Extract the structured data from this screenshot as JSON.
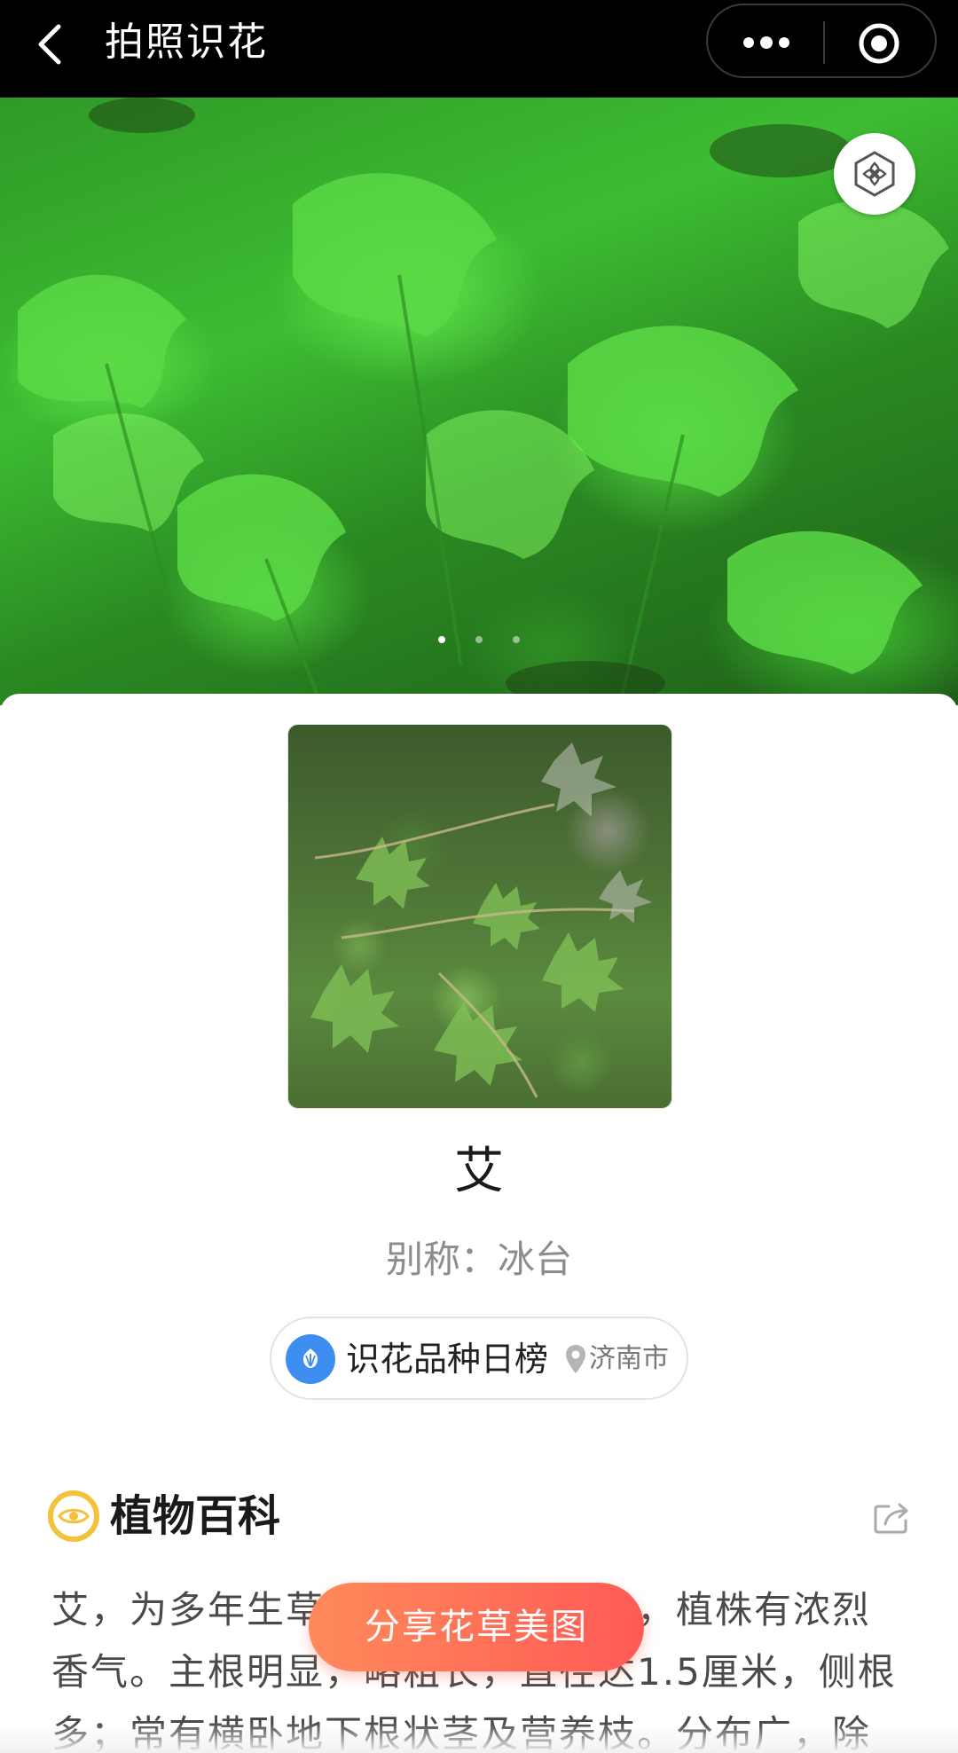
{
  "navbar": {
    "title": "拍照识花",
    "back_icon": "chevron-left-icon",
    "more_icon": "more-dots-icon",
    "close_icon": "target-circle-icon"
  },
  "hero": {
    "badge_icon": "flower-hexagon-icon",
    "carousel": {
      "count": 3,
      "active_index": 0
    }
  },
  "plant": {
    "name": "艾",
    "alias": "别称：冰台"
  },
  "rank": {
    "icon": "tulip-icon",
    "label": "识花品种日榜",
    "pin_icon": "location-pin-icon",
    "city": "济南市"
  },
  "encyclopedia": {
    "icon": "eye-icon",
    "title": "植物百科",
    "share_icon": "share-icon",
    "description": "艾，为多年生草本或略成半灌木状，植株有浓烈香气。主根明显，略粗长，直径达1.5厘米，侧根多；常有横卧地下根状茎及营养枝。分布广，除极干旱与"
  },
  "share_button": {
    "label": "分享花草美图"
  },
  "colors": {
    "navbar_bg": "#000000",
    "accent_blue": "#3d8ef0",
    "accent_yellow": "#f3c13c",
    "share_gradient_start": "#ff8a5a",
    "share_gradient_end": "#ff5a56"
  }
}
